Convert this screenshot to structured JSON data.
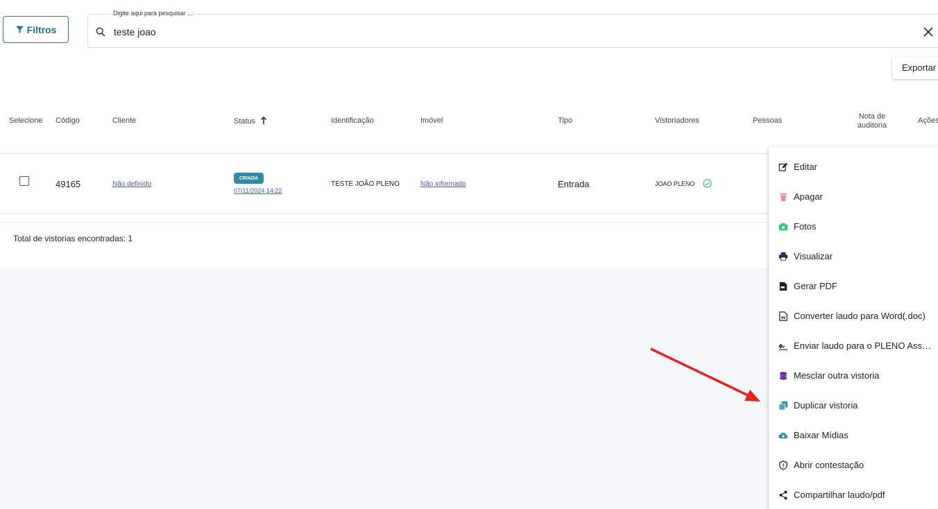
{
  "toolbar": {
    "filter_label": "Filtros",
    "search_label": "Digite aqui para pesquisar ...",
    "search_value": "teste joao",
    "export_label": "Exportar"
  },
  "table": {
    "headers": {
      "select": "Selecione",
      "code": "Código",
      "client": "Cliente",
      "status": "Status",
      "identification": "Identificação",
      "property": "Imóvel",
      "type": "Tipo",
      "inspectors": "Vistoriadores",
      "people": "Pessoas",
      "audit_note_1": "Nota de",
      "audit_note_2": "auditoria",
      "actions": "Ações"
    },
    "row": {
      "code": "49165",
      "client": "Não definido",
      "status_badge": "CRIADA",
      "status_date": "07/11/2024 14:22",
      "identification": "TESTE JOÃO PLENO",
      "property": "Não informado",
      "type": "Entrada",
      "inspector": "JOAO PLENO"
    },
    "total": "Total de vistorias encontradas: 1"
  },
  "menu": {
    "items": [
      {
        "label": "Editar",
        "icon": "edit-icon"
      },
      {
        "label": "Apagar",
        "icon": "trash-icon"
      },
      {
        "label": "Fotos",
        "icon": "camera-icon"
      },
      {
        "label": "Visualizar",
        "icon": "printer-icon"
      },
      {
        "label": "Gerar PDF",
        "icon": "pdf-icon"
      },
      {
        "label": "Converter laudo para Word(.doc)",
        "icon": "word-icon"
      },
      {
        "label": "Enviar laudo para o PLENO Assin...",
        "icon": "signature-icon"
      },
      {
        "label": "Mesclar outra vistoria",
        "icon": "layers-icon"
      },
      {
        "label": "Duplicar vistoria",
        "icon": "duplicate-icon"
      },
      {
        "label": "Baixar Mídias",
        "icon": "cloud-download-icon"
      },
      {
        "label": "Abrir contestação",
        "icon": "shield-icon"
      },
      {
        "label": "Compartilhar laudo/pdf",
        "icon": "share-icon"
      }
    ]
  },
  "colors": {
    "accent": "#2e8ba8",
    "link": "#3b5fc0",
    "arrow": "#e02424"
  }
}
